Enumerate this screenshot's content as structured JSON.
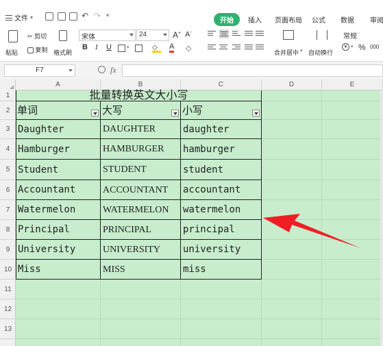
{
  "menubar": {
    "file_label": "文件",
    "tabs": [
      {
        "label": "开始",
        "active": true
      },
      {
        "label": "插入"
      },
      {
        "label": "页面布局"
      },
      {
        "label": "公式"
      },
      {
        "label": "数据"
      },
      {
        "label": "审阅"
      }
    ]
  },
  "ribbon": {
    "paste": "粘贴",
    "cut": "剪切",
    "copy": "复制",
    "format_painter": "格式刷",
    "font_name": "宋体",
    "font_size": "24",
    "merge_center": "合并居中",
    "wrap_text": "自动换行",
    "number_format": "常规",
    "percent": "%",
    "comma": "000"
  },
  "formula_bar": {
    "cell_ref": "F7",
    "fx": "fx",
    "value": ""
  },
  "sheet": {
    "columns": [
      "A",
      "B",
      "C",
      "D",
      "E"
    ],
    "rows": [
      "1",
      "2",
      "3",
      "4",
      "5",
      "6",
      "7",
      "8",
      "9",
      "10",
      "11",
      "12",
      "13"
    ],
    "title": "批量转换英文大小写",
    "headers": [
      "单词",
      "大写",
      "小写"
    ],
    "data": [
      [
        "Daughter",
        "DAUGHTER",
        "daughter"
      ],
      [
        "Hamburger",
        "HAMBURGER",
        "hamburger"
      ],
      [
        "Student",
        "STUDENT",
        "student"
      ],
      [
        "Accountant",
        "ACCOUNTANT",
        "accountant"
      ],
      [
        "Watermelon",
        "WATERMELON",
        "watermelon"
      ],
      [
        "Principal",
        "PRINCIPAL",
        "principal"
      ],
      [
        "University",
        "UNIVERSITY",
        "university"
      ],
      [
        "Miss",
        "MISS",
        "miss"
      ]
    ]
  },
  "colors": {
    "accent": "#2fb171",
    "sheet_bg": "#c7edcc",
    "annotation_arrow": "#f01d24"
  }
}
